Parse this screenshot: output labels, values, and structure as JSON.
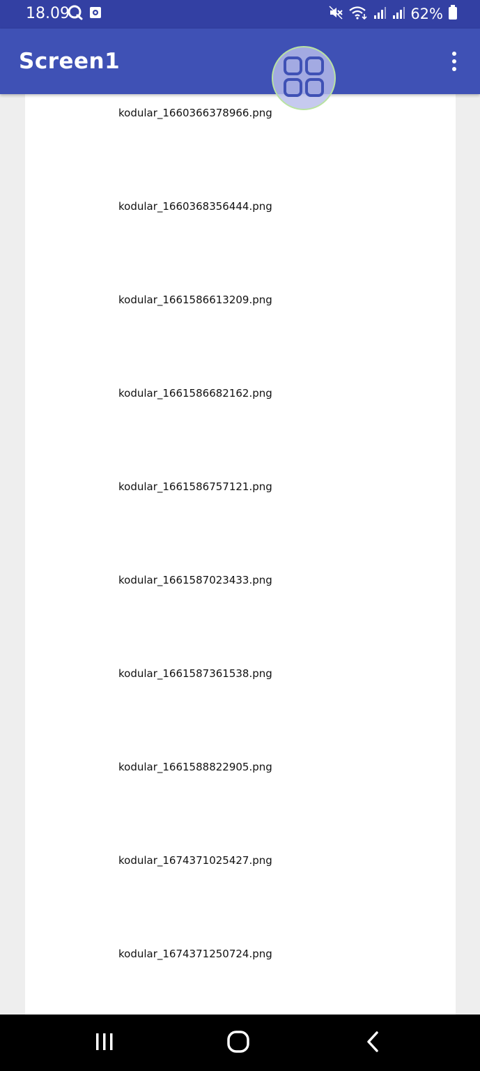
{
  "status_bar": {
    "time": "18.09",
    "battery_percent": "62%",
    "left_icons": [
      "chat-bubble-icon",
      "camera-notification-icon"
    ],
    "right_icons": [
      "mute-icon",
      "wifi-icon",
      "signal-icon",
      "signal-icon",
      "battery-icon"
    ]
  },
  "app_bar": {
    "title": "Screen1",
    "menu_icon": "more-vert-icon"
  },
  "floating_button": {
    "icon": "grid-apps-icon"
  },
  "files": [
    "kodular_1660366378966.png",
    "kodular_1660368356444.png",
    "kodular_1661586613209.png",
    "kodular_1661586682162.png",
    "kodular_1661586757121.png",
    "kodular_1661587023433.png",
    "kodular_1661587361538.png",
    "kodular_1661588822905.png",
    "kodular_1674371025427.png",
    "kodular_1674371250724.png"
  ],
  "nav_bar": {
    "buttons": [
      "recent-apps-icon",
      "home-icon",
      "back-icon"
    ]
  },
  "colors": {
    "status_bar": "#3340a3",
    "app_bar": "#3f51b5",
    "background": "#eeeeee",
    "content": "#ffffff",
    "nav_bar": "#000000"
  }
}
